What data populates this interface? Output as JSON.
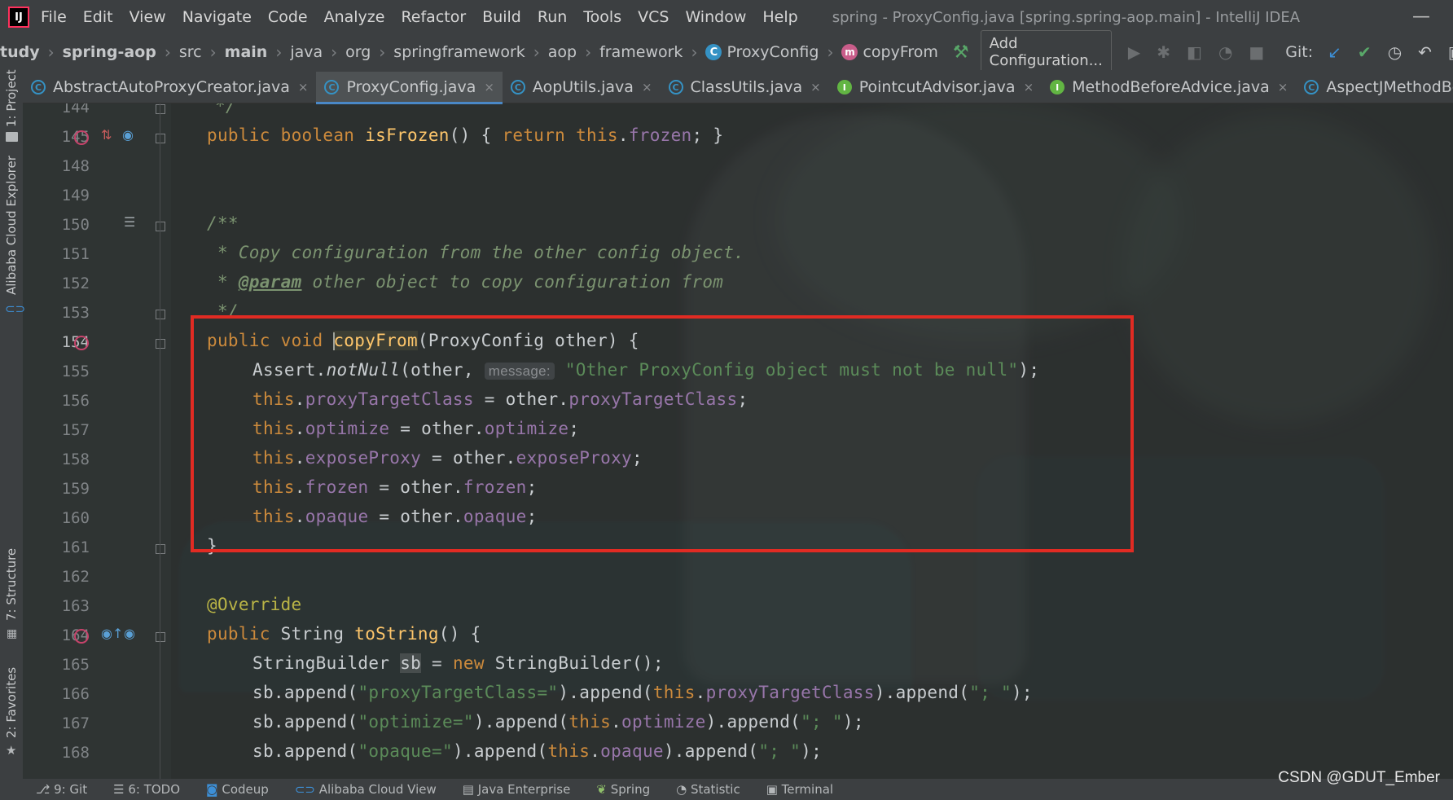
{
  "window": {
    "app_icon": "IJ",
    "title": "spring - ProxyConfig.java [spring.spring-aop.main] - IntelliJ IDEA",
    "minimize_glyph": "—"
  },
  "menu": [
    "File",
    "Edit",
    "View",
    "Navigate",
    "Code",
    "Analyze",
    "Refactor",
    "Build",
    "Run",
    "Tools",
    "VCS",
    "Window",
    "Help"
  ],
  "breadcrumb": {
    "items": [
      "tudy",
      "spring-aop",
      "src",
      "main",
      "java",
      "org",
      "springframework",
      "aop",
      "framework"
    ],
    "class_name": "ProxyConfig",
    "method_name": "copyFrom",
    "class_badge": "C",
    "method_badge": "m"
  },
  "toolbar": {
    "config_label": "Add Configuration...",
    "git_label": "Git:"
  },
  "tabs": [
    {
      "label": "AbstractAutoProxyCreator.java",
      "icon": "C",
      "kind": "class"
    },
    {
      "label": "ProxyConfig.java",
      "icon": "C",
      "kind": "class",
      "active": true
    },
    {
      "label": "AopUtils.java",
      "icon": "C",
      "kind": "class"
    },
    {
      "label": "ClassUtils.java",
      "icon": "C",
      "kind": "class"
    },
    {
      "label": "PointcutAdvisor.java",
      "icon": "I",
      "kind": "interface"
    },
    {
      "label": "MethodBeforeAdvice.java",
      "icon": "I",
      "kind": "interface"
    },
    {
      "label": "AspectJMethodBeforeAdv",
      "icon": "C",
      "kind": "class"
    }
  ],
  "tab_close_glyph": "×",
  "left_tools": {
    "project": "1: Project",
    "cloud": "Alibaba Cloud Explorer",
    "structure": "7: Structure",
    "favorites": "2: Favorites"
  },
  "line_numbers": [
    "144",
    "145",
    "148",
    "149",
    "150",
    "151",
    "152",
    "153",
    "154",
    "155",
    "156",
    "157",
    "158",
    "159",
    "160",
    "161",
    "162",
    "163",
    "164",
    "165",
    "166",
    "167",
    "168"
  ],
  "code": {
    "l144": "*/",
    "l145_kw1": "public",
    "l145_kw2": "boolean",
    "l145_fn": "isFrozen",
    "l145_a": "() { ",
    "l145_kw3": "return",
    "l145_kw4": "this",
    "l145_fld": "frozen",
    "l145_b": "; }",
    "l150": "/**",
    "l151": " * Copy configuration from the other config object.",
    "l152_star": " * ",
    "l152_tag": "@param",
    "l152_rest": " other object to copy configuration from",
    "l153": " */",
    "l154_kw1": "public",
    "l154_kw2": "void",
    "l154_fn": "copyFrom",
    "l154_rest": "(ProxyConfig other) {",
    "l155_a": "Assert.",
    "l155_m": "notNull",
    "l155_b": "(other, ",
    "l155_hint": "message:",
    "l155_str": "\"Other ProxyConfig object must not be null\"",
    "l155_c": ");",
    "l156_f": "proxyTargetClass",
    "l157_f": "optimize",
    "l158_f": "exposeProxy",
    "l159_f": "frozen",
    "l160_f": "opaque",
    "this_kw": "this",
    "other": "other",
    "close_brace": "}",
    "l163": "@Override",
    "l164_kw1": "public",
    "l164_type": "String",
    "l164_fn": "toString",
    "l164_rest": "() {",
    "l165_a": "StringBuilder ",
    "l165_var": "sb",
    "l165_b": " = ",
    "l165_kw": "new",
    "l165_c": " StringBuilder();",
    "l166_s1": "\"proxyTargetClass=\"",
    "l166_f": "proxyTargetClass",
    "l167_s1": "\"optimize=\"",
    "l167_f": "optimize",
    "l168_s1": "\"opaque=\"",
    "l168_f": "opaque",
    "sep_str": "\"; \"",
    "sb_append": "sb.append(",
    "append_mid": ").append(",
    "append_end": ");"
  },
  "bottom_tools": [
    "9: Git",
    "6: TODO",
    "Codeup",
    "Alibaba Cloud View",
    "Java Enterprise",
    "Spring",
    "Statistic",
    "Terminal"
  ],
  "watermark": "CSDN @GDUT_Ember",
  "highlight_color": "#e12b23"
}
